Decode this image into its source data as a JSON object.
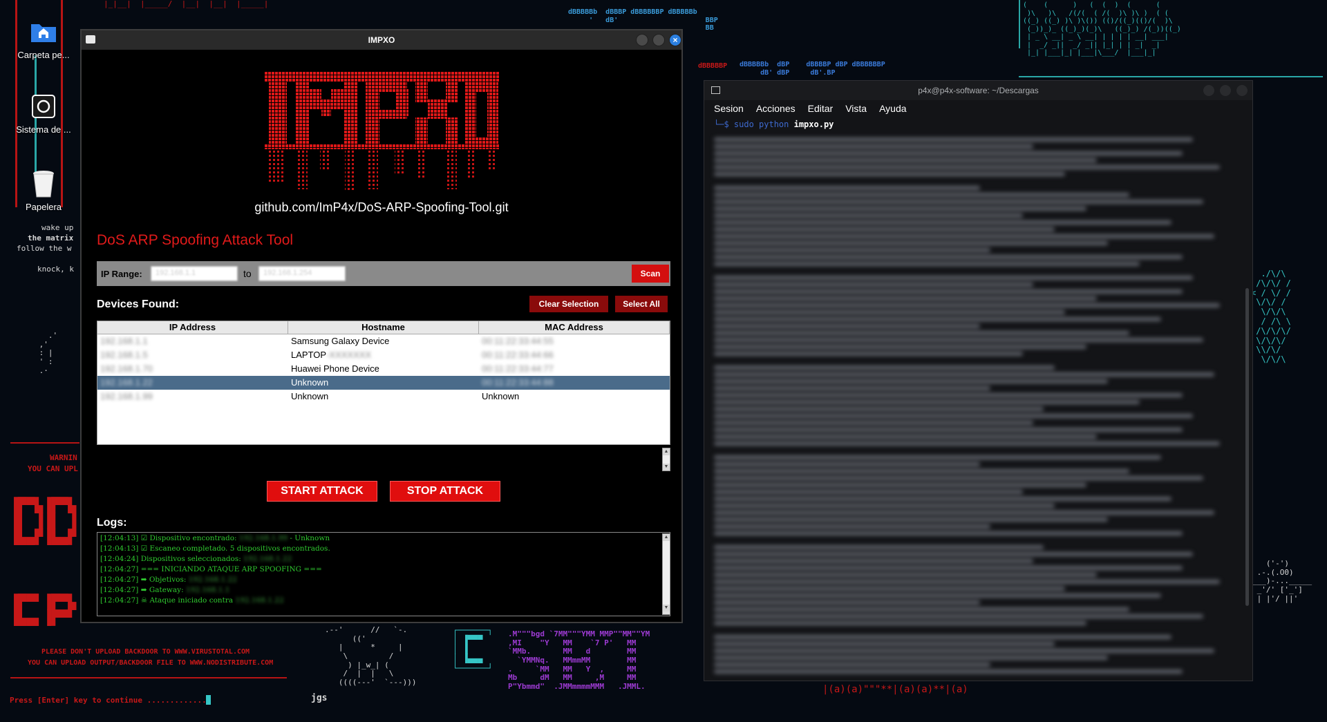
{
  "desktop": {
    "icons": [
      {
        "label": "Carpeta pe...",
        "icon": "home-folder-icon"
      },
      {
        "label": "Sistema de ...",
        "icon": "system-disk-icon"
      },
      {
        "label": "Papelera",
        "icon": "trash-icon"
      }
    ],
    "wallpaper_text": {
      "wake": "wake up",
      "matrix": "the matrix",
      "follow": "follow the w",
      "knock": "knock, k",
      "warning": "WARNIN",
      "upload": "YOU CAN UPL",
      "notice1": "PLEASE DON'T UPLOAD BACKDOOR TO WWW.VIRUSTOTAL.COM",
      "notice2": "YOU CAN UPLOAD OUTPUT/BACKDOOR FILE TO WWW.NODISTRIBUTE.COM",
      "press_enter": "Press [Enter] key to continue .............",
      "jgs": "jgs"
    }
  },
  "impxo": {
    "window_title": "IMPXO",
    "logo_text": "IMPXO",
    "repo_url": "github.com/ImP4x/DoS-ARP-Spoofing-Tool.git",
    "tool_title": "DoS ARP Spoofing Attack Tool",
    "ip_range_label": "IP Range:",
    "ip_from": "192.168.1.1",
    "to_label": "to",
    "ip_to": "192.168.1.254",
    "scan_label": "Scan",
    "devices_label": "Devices Found:",
    "clear_selection_label": "Clear Selection",
    "select_all_label": "Select All",
    "columns": [
      "IP Address",
      "Hostname",
      "MAC Address"
    ],
    "rows": [
      {
        "ip": "192.168.1.1",
        "hostname": "Samsung Galaxy Device",
        "hostname_extra": "",
        "mac": "00:11:22:33:44:55",
        "selected": false
      },
      {
        "ip": "192.168.1.5",
        "hostname": "LAPTOP",
        "hostname_extra": "-XXXXXXX",
        "mac": "00:11:22:33:44:66",
        "selected": false
      },
      {
        "ip": "192.168.1.70",
        "hostname": "Huawei Phone Device",
        "hostname_extra": "",
        "mac": "00:11:22:33:44:77",
        "selected": false
      },
      {
        "ip": "192.168.1.22",
        "hostname": "Unknown",
        "hostname_extra": "",
        "mac": "00:11:22:33:44:88",
        "selected": true
      },
      {
        "ip": "192.168.1.99",
        "hostname": "Unknown",
        "hostname_extra": "",
        "mac": "Unknown",
        "selected": false
      }
    ],
    "start_attack_label": "START ATTACK",
    "stop_attack_label": "STOP ATTACK",
    "logs_label": "Logs:",
    "logs": [
      {
        "text": "[12:04:13] ☑ Dispositivo encontrado: ",
        "hidden": "192.168.1.99",
        "tail": " - Unknown"
      },
      {
        "text": "[12:04:13] ☑ Escaneo completado. 5 dispositivos encontrados.",
        "hidden": "",
        "tail": ""
      },
      {
        "text": "[12:04:24] Dispositivos seleccionados: ",
        "hidden": "192.168.1.22",
        "tail": ""
      },
      {
        "text": "[12:04:27]  === INICIANDO ATAQUE ARP SPOOFING ===",
        "hidden": "",
        "tail": ""
      },
      {
        "text": "[12:04:27] ➡ Objetivos: ",
        "hidden": "192.168.1.22",
        "tail": ""
      },
      {
        "text": "[12:04:27] ➡ Gateway: ",
        "hidden": "192.168.1.1",
        "tail": ""
      },
      {
        "text": "[12:04:27] ☠ Ataque iniciado contra ",
        "hidden": "192.168.1.22",
        "tail": ""
      }
    ]
  },
  "terminal": {
    "window_title": "p4x@p4x-software: ~/Descargas",
    "menu": [
      "Sesion",
      "Acciones",
      "Editar",
      "Vista",
      "Ayuda"
    ],
    "prompt_prefix": "└─$ ",
    "command": "sudo python ",
    "file": "impxo.py"
  }
}
